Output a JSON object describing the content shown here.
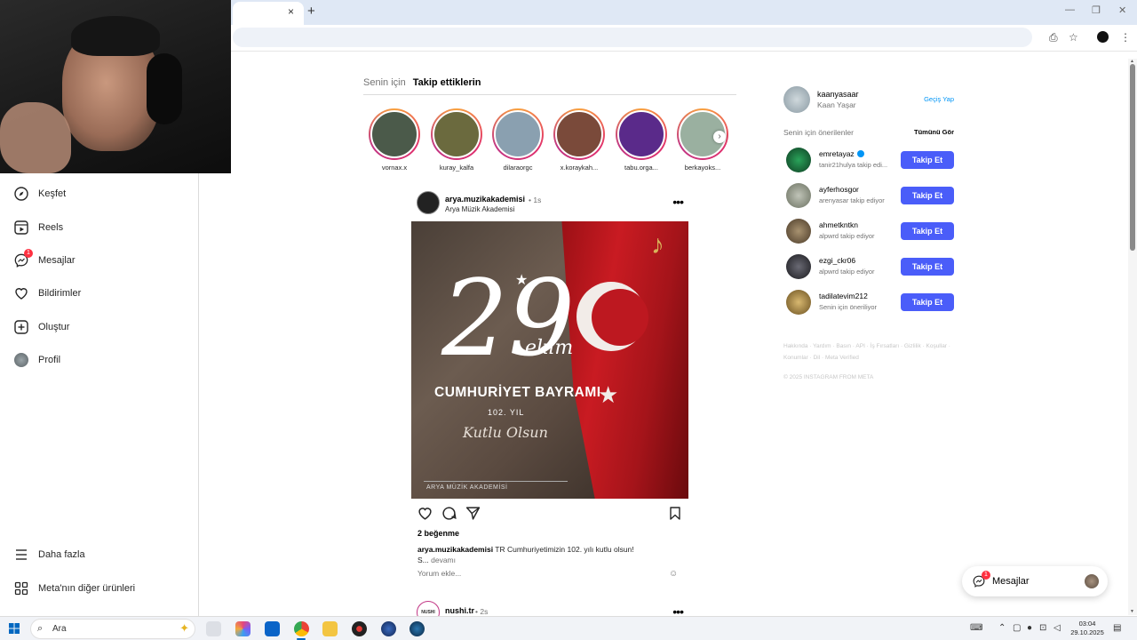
{
  "browser": {
    "tab_close": "×",
    "tab_new": "+",
    "win_min": "—",
    "win_restore": "❐",
    "win_close": "✕"
  },
  "sidebar": {
    "items": [
      {
        "label": "Keşfet",
        "icon": "compass-icon"
      },
      {
        "label": "Reels",
        "icon": "reels-icon"
      },
      {
        "label": "Mesajlar",
        "icon": "messenger-icon",
        "badge": "1"
      },
      {
        "label": "Bildirimler",
        "icon": "heart-icon"
      },
      {
        "label": "Oluştur",
        "icon": "plus-square-icon"
      },
      {
        "label": "Profil",
        "icon": "avatar-icon"
      }
    ],
    "bottom": [
      {
        "label": "Daha fazla",
        "icon": "menu-icon"
      },
      {
        "label": "Meta'nın diğer ürünleri",
        "icon": "grid-icon"
      }
    ]
  },
  "feed": {
    "tabs": [
      {
        "label": "Senin için"
      },
      {
        "label": "Takip ettiklerin"
      }
    ],
    "stories": [
      {
        "name": "vornax.x",
        "color": "#4b5a4a"
      },
      {
        "name": "kuray_kalfa",
        "color": "#6b6a3e"
      },
      {
        "name": "dilaraorgc",
        "color": "#8aa0b0"
      },
      {
        "name": "x.koraykah...",
        "color": "#7a4a3a"
      },
      {
        "name": "tabu.orga...",
        "color": "#5a2a8a"
      },
      {
        "name": "berkayoks...",
        "color": "#9ab0a0"
      }
    ],
    "story_next": "›",
    "post": {
      "username": "arya.muzikakademisi",
      "time": "• 1s",
      "subtitle": "Arya Müzik Akademisi",
      "more": "•••",
      "image": {
        "big_number": "29",
        "month": "ekim",
        "title": "CUMHURİYET BAYRAMI",
        "year": "102. YIL",
        "script": "Kutlu Olsun",
        "watermark": "ARYA MÜZİK AKADEMİSİ",
        "star": "★",
        "flag_star": "★",
        "note": "♪"
      },
      "likes": "2 beğenme",
      "caption_user": "arya.muzikakademisi",
      "caption_text": "TR Cumhuriyetimizin 102. yılı kutlu olsun!",
      "caption_more_pre": "S... ",
      "caption_more": "devamı",
      "comment_placeholder": "Yorum ekle...",
      "emoji": "☺"
    },
    "next_post": {
      "avatar_text": "NUSHI",
      "username": "nushi.tr",
      "time": "• 2s",
      "more": "•••"
    }
  },
  "right": {
    "me": {
      "username": "kaanyasaar",
      "name": "Kaan Yaşar",
      "switch": "Geçiş Yap"
    },
    "suggest_title": "Senin için önerilenler",
    "see_all": "Tümünü Gör",
    "suggestions": [
      {
        "username": "emretayaz",
        "verified": true,
        "sub": "tanir21hulya takip edi...",
        "button": "Takip Et",
        "color": "#1f6b3a"
      },
      {
        "username": "ayferhosgor",
        "verified": false,
        "sub": "arenyasar takip ediyor",
        "button": "Takip Et",
        "color": "#9aa090"
      },
      {
        "username": "ahmetkntkn",
        "verified": false,
        "sub": "alpwrd takip ediyor",
        "button": "Takip Et",
        "color": "#7a6a50"
      },
      {
        "username": "ezgi_ckr06",
        "verified": false,
        "sub": "alpwrd takip ediyor",
        "button": "Takip Et",
        "color": "#3a3a40"
      },
      {
        "username": "tadilatevim212",
        "verified": false,
        "sub": "Senin için öneriliyor",
        "button": "Takip Et",
        "color": "#b09050"
      }
    ],
    "footer_links": "Hakkında · Yardım · Basın · API · İş Fırsatları · Gizlilik · Koşullar · Konumlar · Dil · Meta Verified",
    "copyright": "© 2025 INSTAGRAM FROM META"
  },
  "messages_pill": {
    "label": "Mesajlar",
    "badge": "1"
  },
  "taskbar": {
    "search_placeholder": "Ara",
    "time": "03:04",
    "date": "29.10.2025",
    "apps": [
      "task-view-icon",
      "copilot-icon",
      "outlook-icon",
      "chrome-icon",
      "file-explorer-icon",
      "app-icon",
      "steam-alt-icon",
      "steam-icon"
    ]
  },
  "colors": {
    "accent": "#4a5df9",
    "link": "#0095f6",
    "badge": "#ff3040"
  }
}
